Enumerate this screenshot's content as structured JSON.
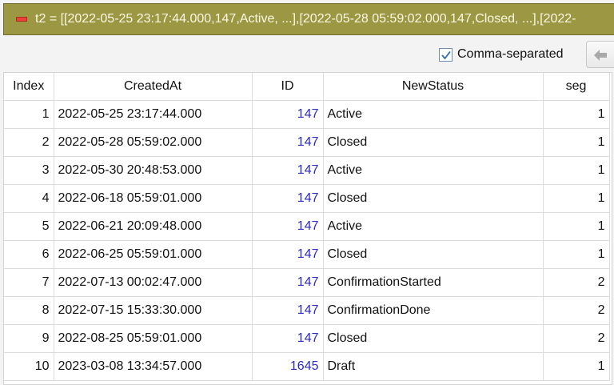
{
  "title_bar": {
    "text": "t2 = [[2022-05-25 23:17:44.000,147,Active, ...],[2022-05-28 05:59:02.000,147,Closed, ...],[2022-"
  },
  "toolbar": {
    "comma_separated_label": "Comma-separated",
    "comma_separated_checked": true,
    "back_icon": "arrow-left-icon"
  },
  "table": {
    "columns": [
      "Index",
      "CreatedAt",
      "ID",
      "NewStatus",
      "seg"
    ],
    "rows": [
      [
        "1",
        "2022-05-25 23:17:44.000",
        "147",
        "Active",
        "1"
      ],
      [
        "2",
        "2022-05-28 05:59:02.000",
        "147",
        "Closed",
        "1"
      ],
      [
        "3",
        "2022-05-30 20:48:53.000",
        "147",
        "Active",
        "1"
      ],
      [
        "4",
        "2022-06-18 05:59:01.000",
        "147",
        "Closed",
        "1"
      ],
      [
        "5",
        "2022-06-21 20:09:48.000",
        "147",
        "Active",
        "1"
      ],
      [
        "6",
        "2022-06-25 05:59:01.000",
        "147",
        "Closed",
        "1"
      ],
      [
        "7",
        "2022-07-13 00:02:47.000",
        "147",
        "ConfirmationStarted",
        "2"
      ],
      [
        "8",
        "2022-07-15 15:33:30.000",
        "147",
        "ConfirmationDone",
        "2"
      ],
      [
        "9",
        "2022-08-25 05:59:01.000",
        "147",
        "Closed",
        "2"
      ],
      [
        "10",
        "2023-03-08 13:34:57.000",
        "1645",
        "Draft",
        "1"
      ]
    ]
  },
  "colors": {
    "title_bar_bg": "#9c9743",
    "id_text": "#2a2ac8",
    "collapse_icon": "#e8423a"
  }
}
